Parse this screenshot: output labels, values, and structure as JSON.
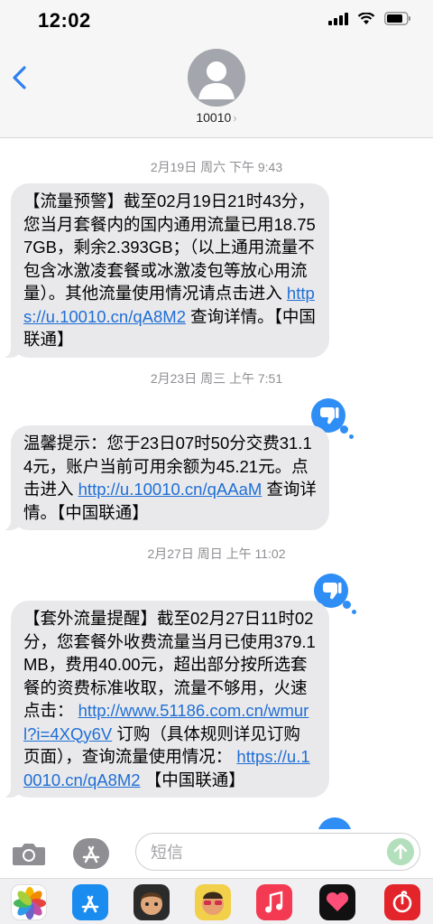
{
  "status_bar": {
    "time": "12:02"
  },
  "header": {
    "contact_name": "10010",
    "chevron": "›"
  },
  "messages": [
    {
      "timestamp": "2月19日 周六 下午 9:43",
      "parts": [
        {
          "text": "【流量预警】截至02月19日21时43分，您当月套餐内的国内通用流量已用18.757GB，剩余2.393GB；（以上通用流量不包含冰激凌套餐或冰激凌包等放心用流量）。其他流量使用情况请点击进入 "
        },
        {
          "text": "https://u.10010.cn/qA8M2",
          "link": true
        },
        {
          "text": " 查询详情。【中国联通】"
        }
      ],
      "reaction": null
    },
    {
      "timestamp": "2月23日 周三 上午 7:51",
      "parts": [
        {
          "text": "温馨提示：您于23日07时50分交费31.14元，账户当前可用余额为45.21元。点击进入 "
        },
        {
          "text": "http://u.10010.cn/qAAaM",
          "link": true
        },
        {
          "text": " 查询详情。【中国联通】"
        }
      ],
      "reaction": "thumbs-down"
    },
    {
      "timestamp": "2月27日 周日 上午 11:02",
      "parts": [
        {
          "text": "【套外流量提醒】截至02月27日11时02分，您套餐外收费流量当月已使用379.1MB，费用40.00元，超出部分按所选套餐的资费标准收取，流量不够用，火速点击： "
        },
        {
          "text": "http://www.51186.com.cn/wmurl?i=4XQy6V",
          "link": true
        },
        {
          "text": " 订购（具体规则详见订购页面），查询流量使用情况： "
        },
        {
          "text": "https://u.10010.cn/qA8M2",
          "link": true
        },
        {
          "text": " 【中国联通】"
        }
      ],
      "reaction": "thumbs-down"
    }
  ],
  "input": {
    "placeholder": "短信"
  },
  "app_drawer": [
    "photos-app",
    "app-store-app",
    "memoji-app",
    "memoji-app-2",
    "music-app",
    "heart-app",
    "netease-music-app"
  ],
  "colors": {
    "link": "#1f6fd6",
    "bubble": "#e9e9eb",
    "tapback": "#2f8ef5",
    "back": "#2f7ff0"
  }
}
